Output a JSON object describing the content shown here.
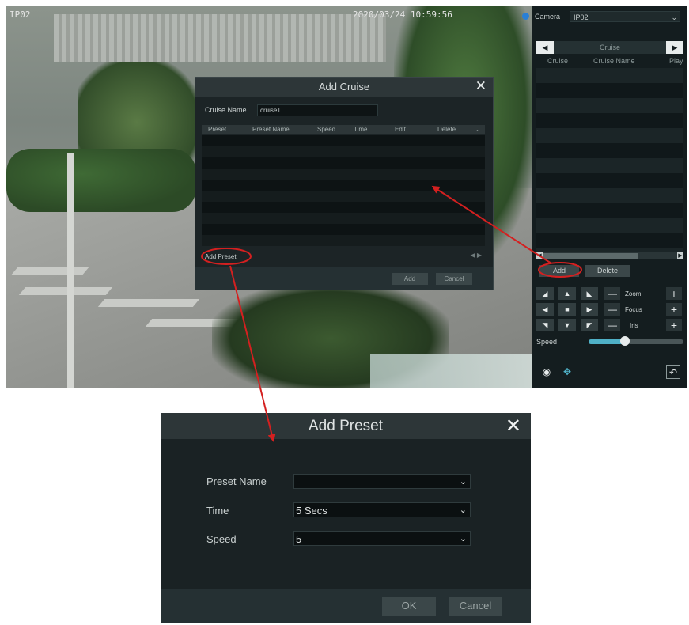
{
  "video": {
    "camera_osd": "IP02",
    "timestamp_osd": "2020/03/24 10:59:56"
  },
  "panel": {
    "camera_label": "Camera",
    "camera_value": "IP02",
    "tab_title": "Cruise",
    "columns": [
      "Cruise",
      "Cruise Name",
      "Play"
    ],
    "add_label": "Add",
    "delete_label": "Delete",
    "zoom_label": "Zoom",
    "focus_label": "Focus",
    "iris_label": "Iris",
    "speed_label": "Speed",
    "speed_level": 0.38
  },
  "cruise_dialog": {
    "title": "Add Cruise",
    "name_label": "Cruise Name",
    "name_value": "cruise1",
    "columns": [
      "Preset",
      "Preset Name",
      "Speed",
      "Time",
      "Edit",
      "Delete"
    ],
    "add_preset_label": "Add Preset",
    "add_label": "Add",
    "cancel_label": "Cancel"
  },
  "preset_dialog": {
    "title": "Add Preset",
    "preset_name_label": "Preset Name",
    "preset_name_value": "",
    "time_label": "Time",
    "time_value": "5 Secs",
    "speed_label": "Speed",
    "speed_value": "5",
    "ok_label": "OK",
    "cancel_label": "Cancel"
  },
  "colors": {
    "annotation": "#d42020",
    "panel_bg": "#141d1f",
    "dialog_bg": "#1a2224",
    "slider_fill": "#4fb0c6"
  },
  "icons": [
    "close-icon",
    "chevron-down-icon",
    "arrow-left-icon",
    "arrow-right-icon",
    "settings-icon",
    "move-icon",
    "return-icon"
  ]
}
